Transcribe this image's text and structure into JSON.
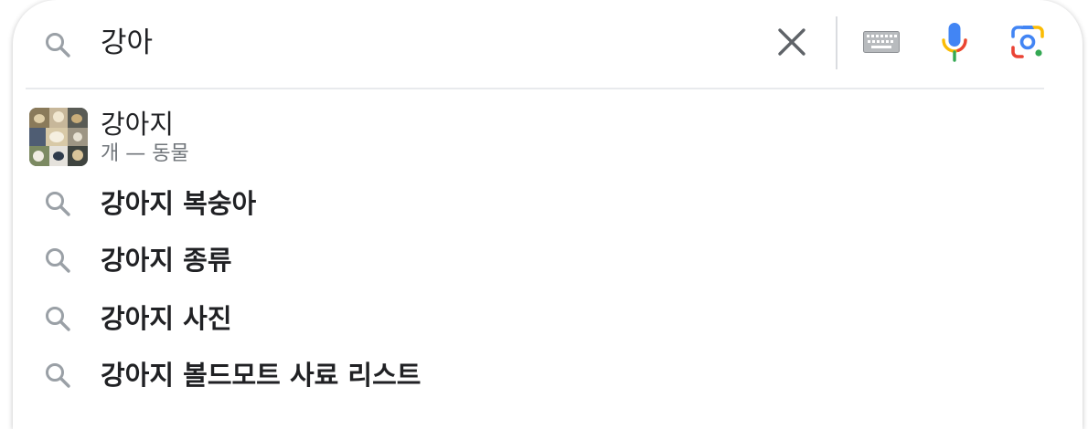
{
  "search": {
    "query": "강아",
    "icon": "search-icon",
    "clear_icon": "close-icon",
    "keyboard_icon": "keyboard-icon",
    "mic_icon": "microphone-icon",
    "lens_icon": "camera-lens-icon"
  },
  "rich_suggestion": {
    "title": "강아지",
    "subtitle": "개 — 동물",
    "thumbnail": "dog-collage-thumbnail"
  },
  "suggestions": [
    {
      "text": "강아지 복숭아"
    },
    {
      "text": "강아지 종류"
    },
    {
      "text": "강아지 사진"
    },
    {
      "text": "강아지 볼드모트 사료 리스트"
    }
  ],
  "colors": {
    "text": "#202124",
    "secondary_text": "#70757a",
    "icon_gray": "#9aa0a6",
    "google_blue": "#4285f4",
    "google_red": "#ea4335",
    "google_yellow": "#fbbc04",
    "google_green": "#34a853"
  }
}
